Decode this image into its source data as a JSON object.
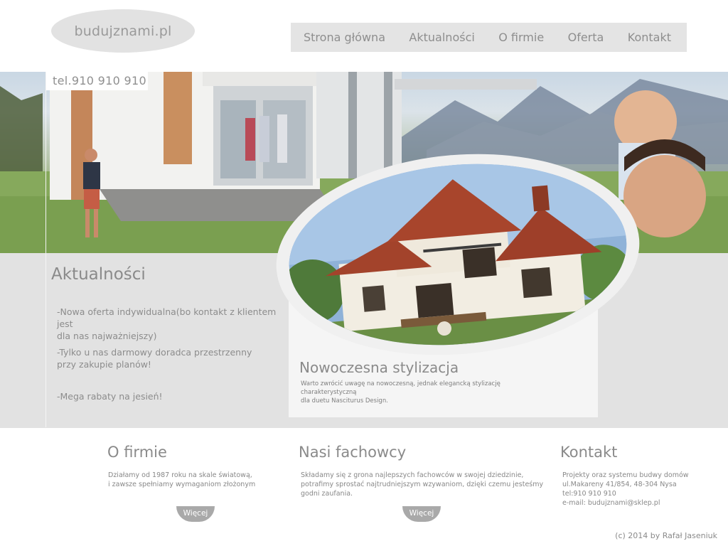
{
  "header": {
    "logo_text": "budujznami.pl",
    "nav": [
      {
        "label": "Strona główna"
      },
      {
        "label": "Aktualności"
      },
      {
        "label": "O firmie"
      },
      {
        "label": "Oferta"
      },
      {
        "label": "Kontakt"
      }
    ]
  },
  "hero": {
    "phone": "tel.910 910 910"
  },
  "news": {
    "title": "Aktualności",
    "items": [
      {
        "line1": "-Nowa oferta indywidualna(bo kontakt z klientem jest",
        "line2": "dla nas najważniejszy)"
      },
      {
        "line1": "-Tylko u nas darmowy doradca przestrzenny",
        "line2": "przy zakupie planów!"
      },
      {
        "line1": "-Mega rabaty na jesień!",
        "line2": ""
      }
    ]
  },
  "feature": {
    "title": "Nowoczesna stylizacja",
    "line1": "Warto zwrócić uwagę na nowoczesną, jednak elegancką stylizację charakterystyczną",
    "line2": "dla duetu Nasciturus Design."
  },
  "about": {
    "title": "O firmie",
    "line1": "Działamy od 1987 roku na skale światową,",
    "line2": "i zawsze spełniamy wymaganiom złożonym",
    "button": "Więcej"
  },
  "experts": {
    "title": "Nasi fachowcy",
    "line1": "Składamy się z grona najlepszych fachowców w swojej dziedzinie,",
    "line2": "potrafimy sprostać najtrudniejszym wzywaniom, dzięki czemu jesteśmy",
    "line3": "godni zaufania.",
    "button": "Więcej"
  },
  "contact": {
    "title": "Kontakt",
    "line1": "Projekty oraz systemu budwy domów",
    "line2": "ul.Makareny 41/854, 48-304 Nysa",
    "line3": "tel:910 910 910",
    "line4": "e-mail: budujznami@sklep.pl"
  },
  "footer": {
    "copyright": "(c) 2014 by Rafał Jaseniuk"
  }
}
